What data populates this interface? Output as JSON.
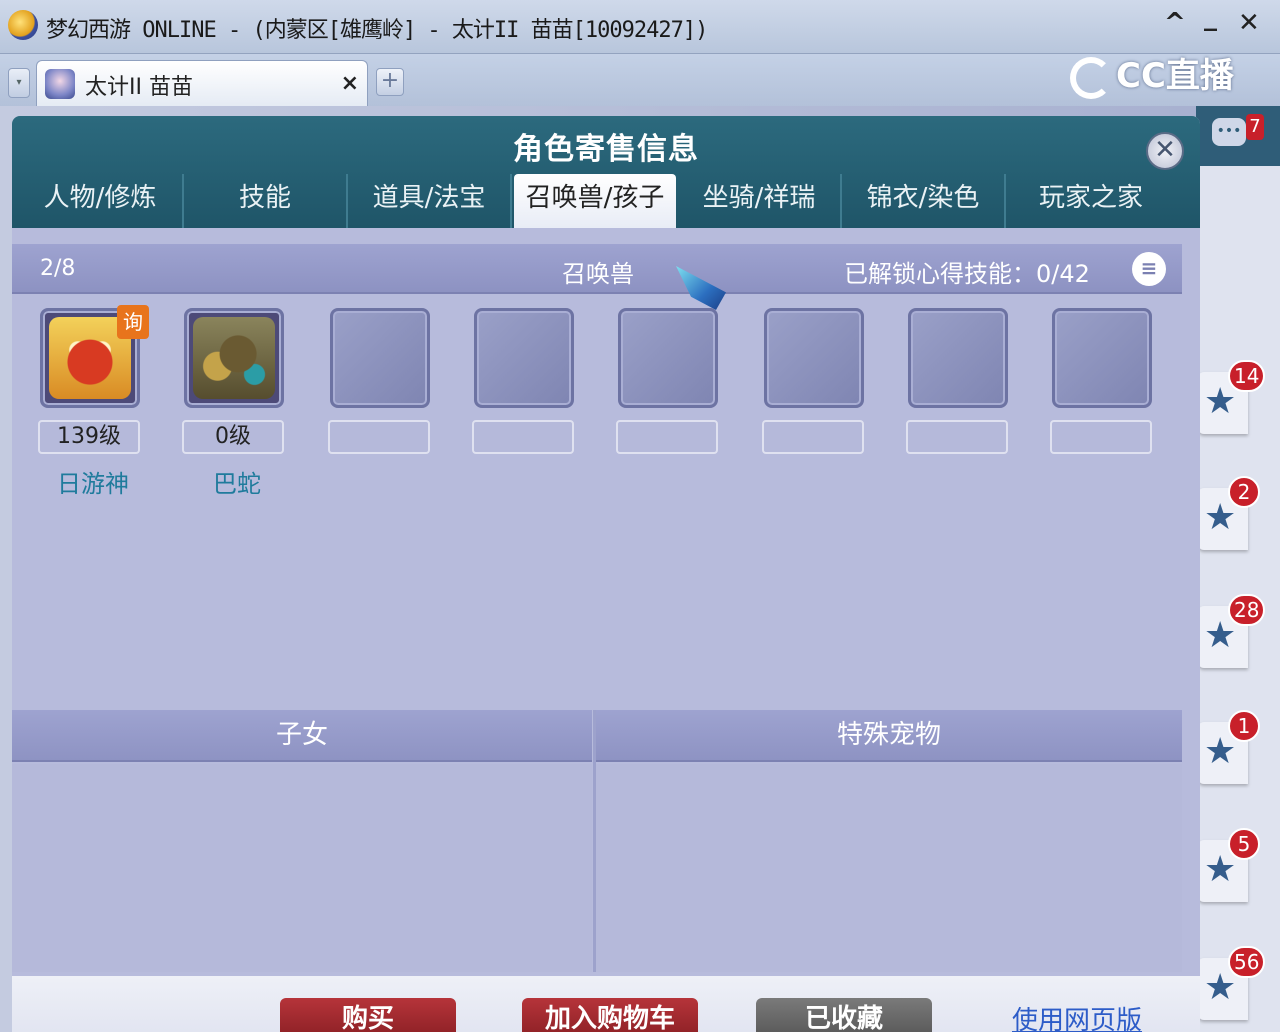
{
  "window": {
    "title": "梦幻西游 ONLINE - (内蒙区[雄鹰岭] - 太计II 苗苗[10092427])",
    "minimize": "_",
    "collapse": "^",
    "close": "✕"
  },
  "tabs": {
    "dropdown": "▾",
    "active_tab": "太计II 苗苗",
    "close": "×",
    "add": "+"
  },
  "watermark": {
    "text": "CC直播"
  },
  "side_panel": {
    "chat_badge": "7",
    "items": [
      {
        "icon": "star-icon",
        "badge": "14"
      },
      {
        "icon": "star-icon",
        "badge": "2"
      },
      {
        "icon": "star-icon",
        "badge": "28"
      },
      {
        "icon": "star-icon",
        "badge": "1"
      },
      {
        "icon": "star-icon",
        "badge": "5"
      },
      {
        "icon": "star-icon",
        "badge": "56"
      }
    ]
  },
  "dialog": {
    "title": "角色寄售信息",
    "close": "✕",
    "tabs": [
      "人物/修炼",
      "技能",
      "道具/法宝",
      "召唤兽/孩子",
      "坐骑/祥瑞",
      "锦衣/染色",
      "玩家之家"
    ],
    "active_tab_index": 3,
    "summons": {
      "count": "2/8",
      "title": "召唤兽",
      "unlock_label": "已解锁心得技能：0/42",
      "menu_icon": "≡",
      "pets": [
        {
          "level": "139级",
          "name": "日游神",
          "badge": "询"
        },
        {
          "level": "0级",
          "name": "巴蛇"
        }
      ],
      "empty_slots": 6
    },
    "children_header": "子女",
    "special_pets_header": "特殊宠物",
    "buttons": {
      "buy": "购买",
      "add_to_cart": "加入购物车",
      "favorited": "已收藏",
      "web_version": "使用网页版"
    }
  }
}
